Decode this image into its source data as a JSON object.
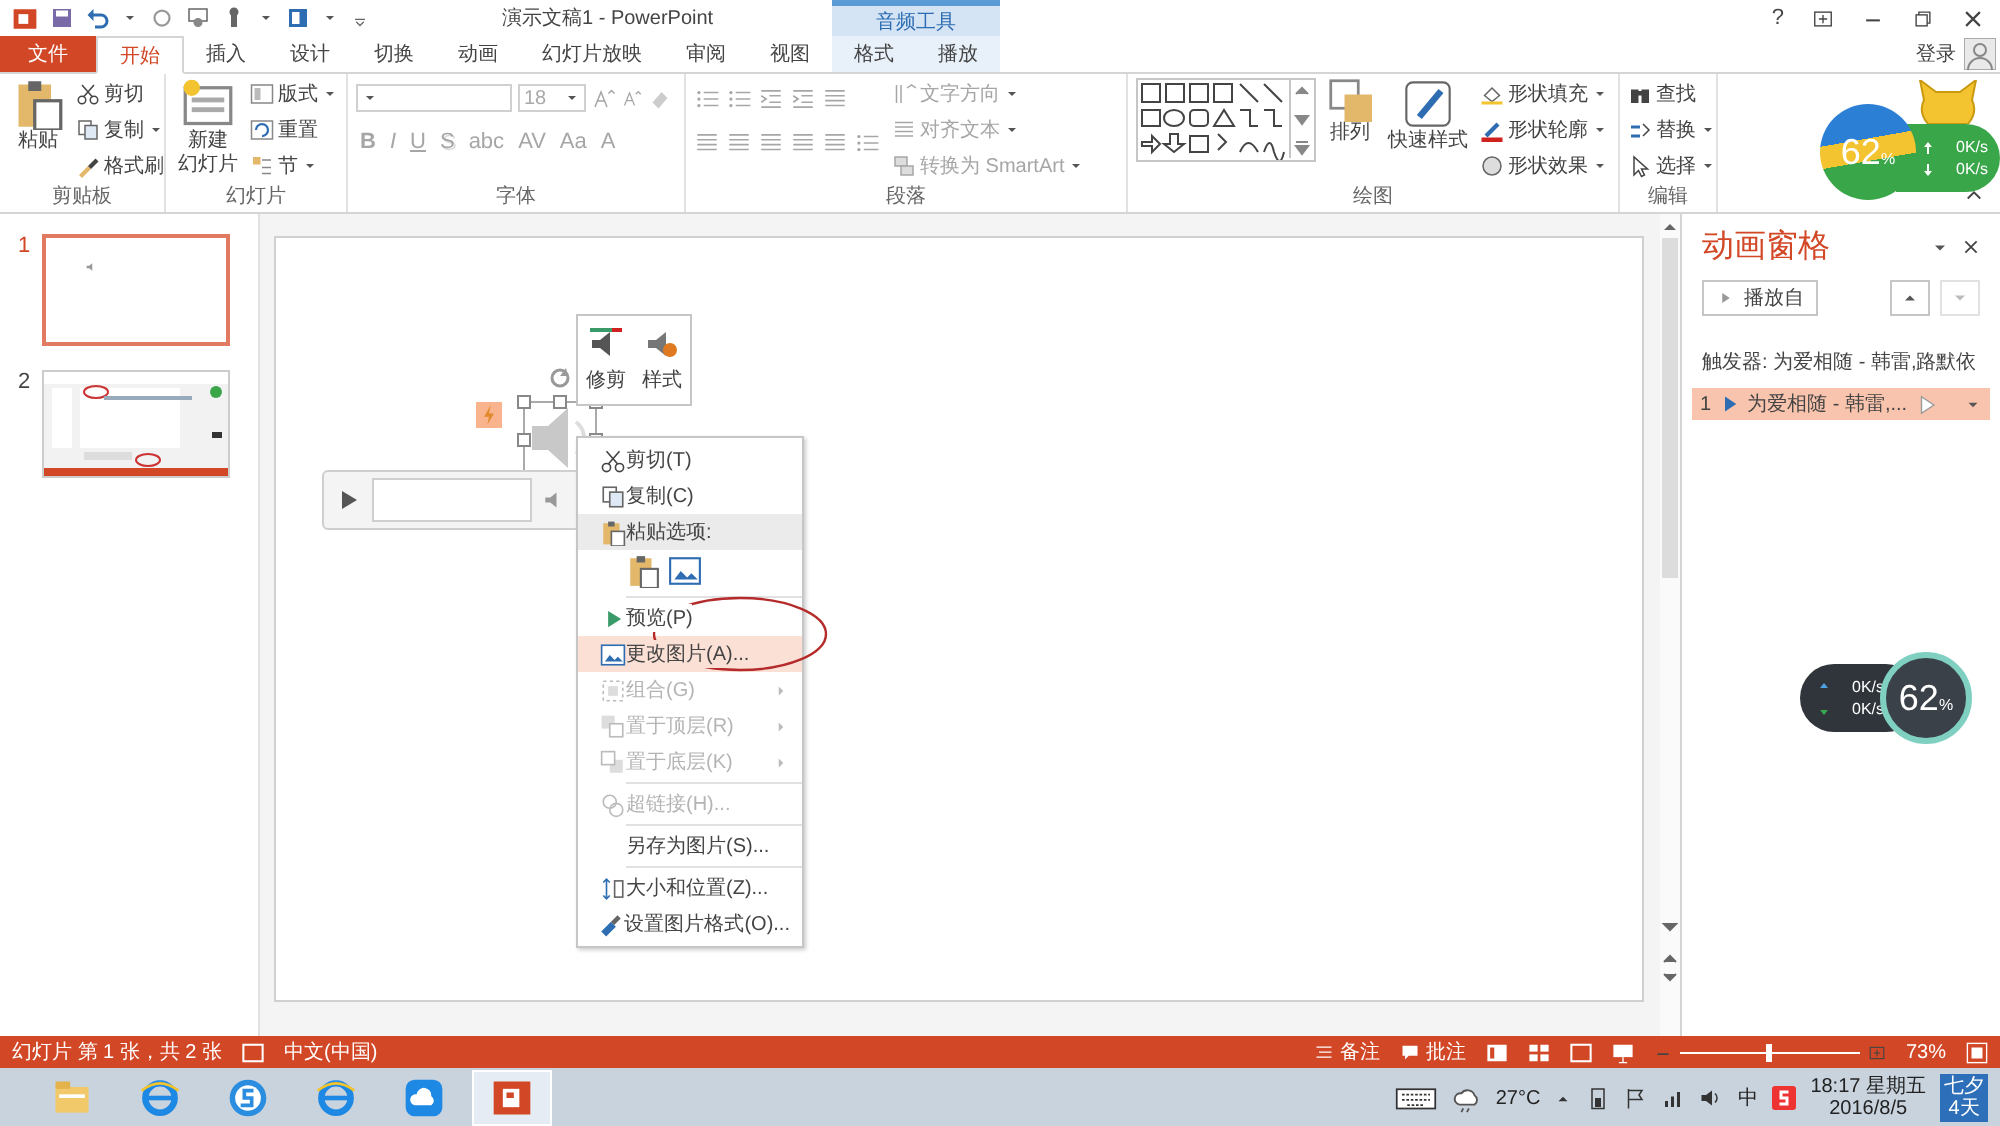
{
  "window": {
    "title": "演示文稿1 - PowerPoint",
    "context_group": "音频工具",
    "help": "?"
  },
  "tabs": [
    {
      "label": "文件",
      "kind": "file",
      "selected": false
    },
    {
      "label": "开始",
      "kind": "normal",
      "selected": true
    },
    {
      "label": "插入",
      "kind": "normal",
      "selected": false
    },
    {
      "label": "设计",
      "kind": "normal",
      "selected": false
    },
    {
      "label": "切换",
      "kind": "normal",
      "selected": false
    },
    {
      "label": "动画",
      "kind": "normal",
      "selected": false
    },
    {
      "label": "幻灯片放映",
      "kind": "normal",
      "selected": false
    },
    {
      "label": "审阅",
      "kind": "normal",
      "selected": false
    },
    {
      "label": "视图",
      "kind": "normal",
      "selected": false
    },
    {
      "label": "格式",
      "kind": "context",
      "selected": false
    },
    {
      "label": "播放",
      "kind": "context",
      "selected": false
    }
  ],
  "account": {
    "label": "登录"
  },
  "ribbon": {
    "groups": [
      {
        "kind": "clipboard",
        "label": "剪贴板",
        "large": [
          "粘贴"
        ],
        "small": [
          "剪切",
          "复制",
          "格式刷"
        ]
      },
      {
        "kind": "slides",
        "label": "幻灯片",
        "large": [
          "新建",
          "幻灯片"
        ],
        "small": [
          "版式",
          "重置",
          "节"
        ]
      },
      {
        "kind": "font",
        "label": "字体",
        "disabled": true,
        "size": "18",
        "buttons": [
          "B",
          "I",
          "U",
          "S",
          "abc",
          "AV",
          "Aa",
          "A"
        ]
      },
      {
        "kind": "paragraph",
        "label": "段落",
        "disabled": true,
        "small": [
          "文字方向",
          "对齐文本",
          "转换为 SmartArt"
        ]
      },
      {
        "kind": "drawing",
        "label": "绘图",
        "large": [
          "排列",
          "快速样式"
        ],
        "small": [
          "形状填充",
          "形状轮廓",
          "形状效果"
        ]
      },
      {
        "kind": "editing",
        "label": "编辑",
        "small": [
          "查找",
          "替换",
          "选择"
        ]
      }
    ]
  },
  "speed_widgets": [
    {
      "kind": "colorful",
      "value": "62",
      "unit": "%",
      "upload": "0K/s",
      "download": "0K/s"
    },
    {
      "kind": "dark",
      "value": "62",
      "unit": "%",
      "upload": "0K/s",
      "download": "0K/s"
    }
  ],
  "thumbnails": [
    {
      "number": "1",
      "selected": true,
      "kind": "blank"
    },
    {
      "number": "2",
      "selected": false,
      "kind": "picture"
    }
  ],
  "mini_toolbar": {
    "items": [
      "修剪",
      "样式"
    ]
  },
  "context_menu": {
    "items": [
      {
        "kind": "command",
        "label": "剪切(T)",
        "disabled": false,
        "selected": false,
        "submenu": false
      },
      {
        "kind": "command",
        "label": "复制(C)",
        "disabled": false,
        "selected": false,
        "submenu": false
      },
      {
        "kind": "header",
        "label": "粘贴选项:"
      },
      {
        "kind": "paste"
      },
      {
        "kind": "separator"
      },
      {
        "kind": "command",
        "label": "预览(P)",
        "disabled": false,
        "selected": false,
        "submenu": false
      },
      {
        "kind": "command",
        "label": "更改图片(A)...",
        "disabled": false,
        "selected": true,
        "submenu": false
      },
      {
        "kind": "command",
        "label": "组合(G)",
        "disabled": true,
        "selected": false,
        "submenu": true
      },
      {
        "kind": "command",
        "label": "置于顶层(R)",
        "disabled": true,
        "selected": false,
        "submenu": true
      },
      {
        "kind": "command",
        "label": "置于底层(K)",
        "disabled": true,
        "selected": false,
        "submenu": true
      },
      {
        "kind": "separator"
      },
      {
        "kind": "command",
        "label": "超链接(H)...",
        "disabled": true,
        "selected": false,
        "submenu": false
      },
      {
        "kind": "separator"
      },
      {
        "kind": "command",
        "label": "另存为图片(S)...",
        "disabled": false,
        "selected": false,
        "submenu": false
      },
      {
        "kind": "separator"
      },
      {
        "kind": "command",
        "label": "大小和位置(Z)...",
        "disabled": false,
        "selected": false,
        "submenu": false
      },
      {
        "kind": "command",
        "label": "设置图片格式(O)...",
        "disabled": false,
        "selected": false,
        "submenu": false
      }
    ],
    "annotations": [
      {
        "kind": "ellipse"
      }
    ]
  },
  "animation_pane": {
    "title": "动画窗格",
    "play_from": "播放自",
    "trigger": "触发器: 为爱相随 - 韩雷,路默依",
    "items": [
      {
        "number": "1",
        "label": "为爱相随 - 韩雷,...",
        "selected": true
      }
    ]
  },
  "status_bar": {
    "slide_info": "幻灯片 第 1 张，共 2 张",
    "language": "中文(中国)",
    "notes": "备注",
    "comments": "批注",
    "zoom_slider": {
      "level": 0.5
    },
    "zoom": "73%"
  },
  "taskbar": {
    "apps": [
      {
        "kind": "folder",
        "active": false
      },
      {
        "kind": "ie",
        "active": false
      },
      {
        "kind": "sogou",
        "active": false
      },
      {
        "kind": "ie",
        "active": false
      },
      {
        "kind": "cloud",
        "active": false
      },
      {
        "kind": "powerpoint",
        "active": true
      }
    ],
    "temperature": "27°C",
    "ime": "中",
    "time": "18:17 星期五",
    "date": "2016/8/5",
    "calendar": [
      "七夕",
      "4天"
    ]
  }
}
